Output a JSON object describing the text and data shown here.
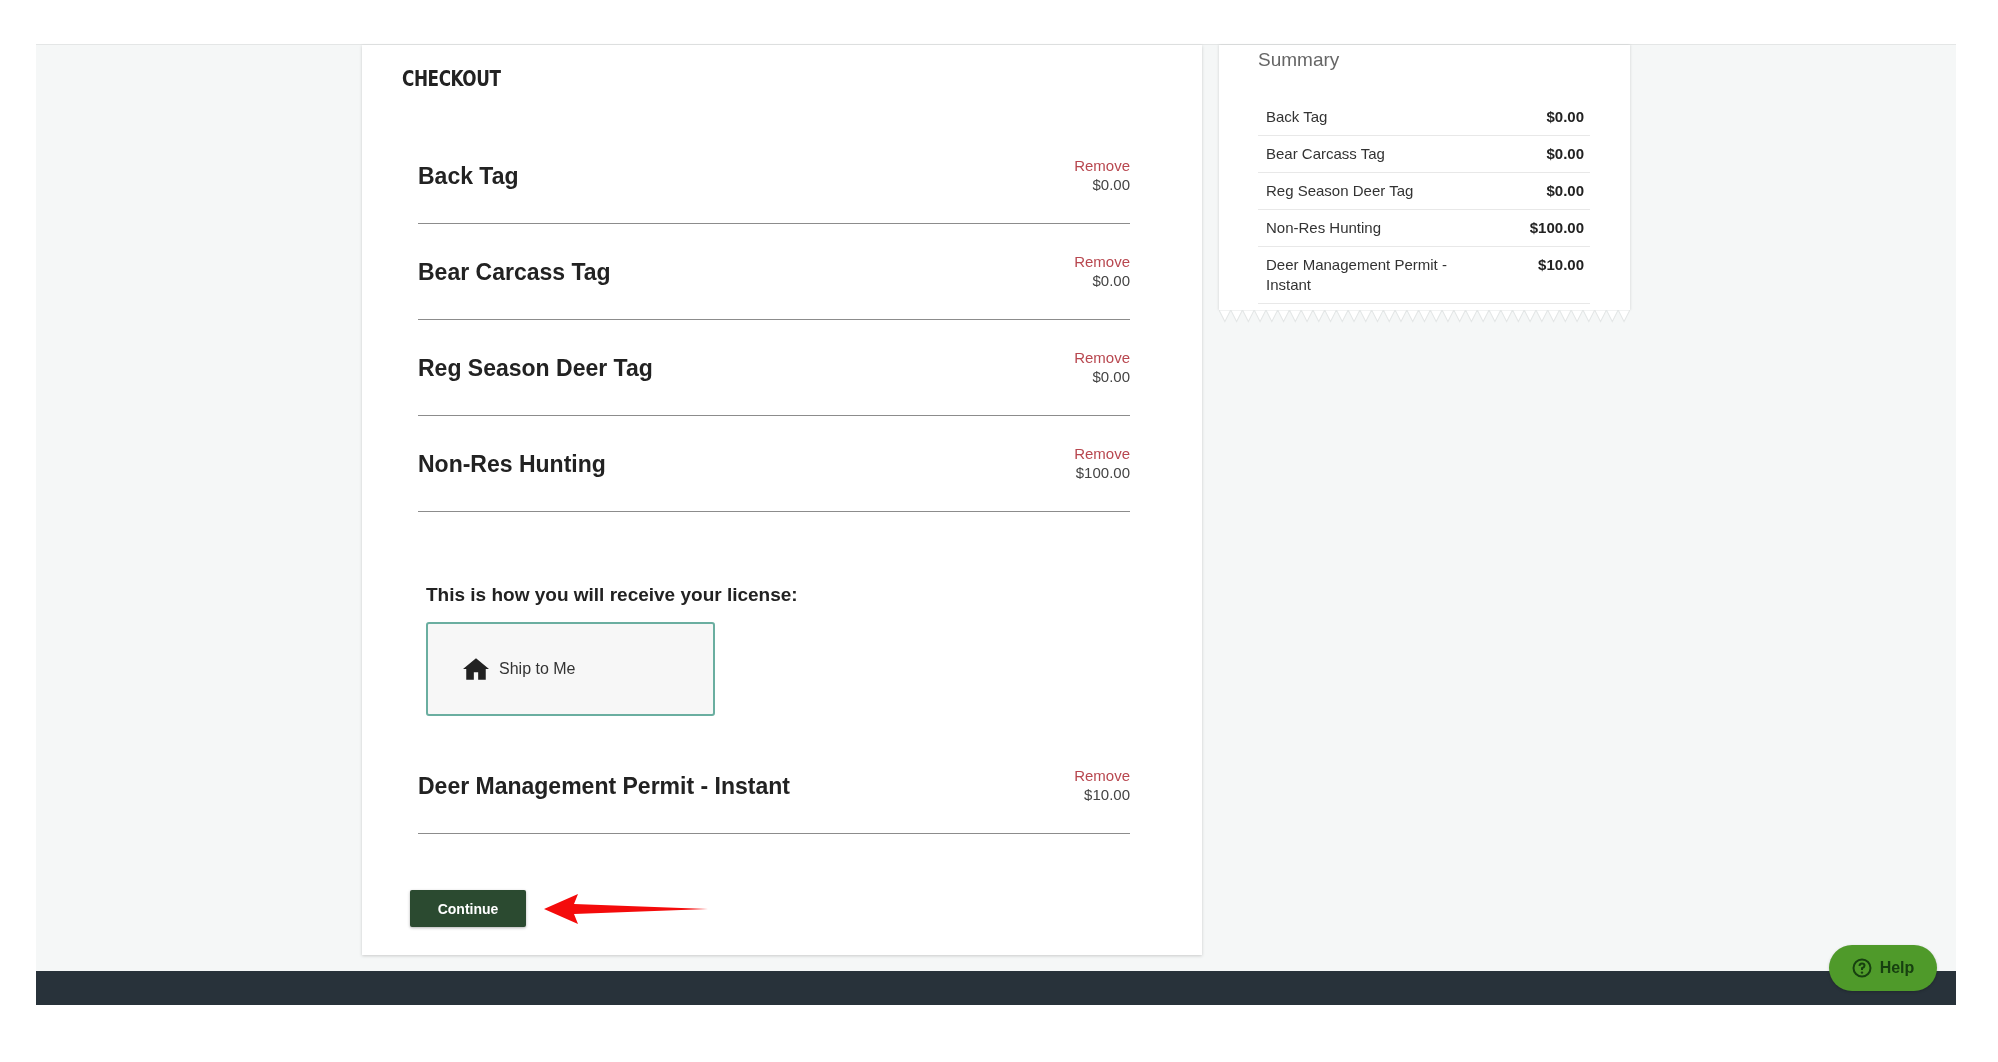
{
  "checkout": {
    "title": "CHECKOUT",
    "lines": [
      {
        "kind": "product",
        "name": "Back Tag",
        "remove": "Remove",
        "price": "$0.00"
      },
      {
        "kind": "product",
        "name": "Bear Carcass Tag",
        "remove": "Remove",
        "price": "$0.00"
      },
      {
        "kind": "product",
        "name": "Reg Season Deer Tag",
        "remove": "Remove",
        "price": "$0.00"
      },
      {
        "kind": "product",
        "name": "Non-Res Hunting",
        "remove": "Remove",
        "price": "$100.00"
      },
      {
        "kind": "delivery",
        "label": "This is how you will receive your license:",
        "options": [
          {
            "label": "Ship to Me",
            "selected": true
          }
        ]
      },
      {
        "kind": "product",
        "name": "Deer Management Permit - Instant",
        "remove": "Remove",
        "price": "$10.00"
      }
    ],
    "continue_button": "Continue"
  },
  "summary": {
    "title": "Summary",
    "rows": [
      {
        "name": "Back Tag",
        "price": "$0.00"
      },
      {
        "name": "Bear Carcass Tag",
        "price": "$0.00"
      },
      {
        "name": "Reg Season Deer Tag",
        "price": "$0.00"
      },
      {
        "name": "Non-Res Hunting",
        "price": "$100.00"
      },
      {
        "name": "Deer Management Permit - Instant",
        "price": "$10.00"
      }
    ]
  },
  "help_button": "Help"
}
